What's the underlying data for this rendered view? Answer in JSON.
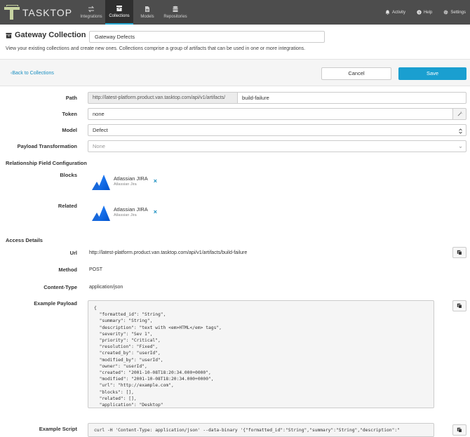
{
  "nav": {
    "logo_text": "TASKTOP",
    "items": [
      {
        "label": "Integrations",
        "icon": "integrations-icon"
      },
      {
        "label": "Collections",
        "icon": "collections-icon",
        "active": true
      },
      {
        "label": "Models",
        "icon": "models-icon"
      },
      {
        "label": "Repositories",
        "icon": "repositories-icon"
      }
    ],
    "right": {
      "activity": "Activity",
      "help": "Help",
      "settings": "Settings"
    },
    "accent_color": "#29abd4"
  },
  "header": {
    "title": "Gateway Collection",
    "name_value": "Gateway Defects",
    "description": "View your existing collections and create new ones. Collections comprise a group of artifacts that can be used in one or more integrations."
  },
  "actions": {
    "back": "Back to Collections",
    "cancel": "Cancel",
    "save": "Save",
    "save_color": "#1a9fd0"
  },
  "form": {
    "path": {
      "label": "Path",
      "prefix": "http://latest-platform.product.van.tasktop.com/api/v1/artifacts/",
      "value": "build-failure"
    },
    "token": {
      "label": "Token",
      "value": "none"
    },
    "model": {
      "label": "Model",
      "value": "Defect"
    },
    "payload_transformation": {
      "label": "Payload Transformation",
      "value": "None"
    }
  },
  "relationships": {
    "title": "Relationship Field Configuration",
    "blocks": {
      "label": "Blocks",
      "item_name": "Atlassian JIRA",
      "item_sub": "Atlassian Jira"
    },
    "related": {
      "label": "Related",
      "item_name": "Atlassian JIRA",
      "item_sub": "Atlassian Jira"
    },
    "remove_glyph": "×"
  },
  "access": {
    "title": "Access Details",
    "url": {
      "label": "Url",
      "value": "http://latest-platform.product.van.tasktop.com/api/v1/artifacts/build-failure"
    },
    "method": {
      "label": "Method",
      "value": "POST"
    },
    "content_type": {
      "label": "Content-Type",
      "value": "application/json"
    },
    "example_payload": {
      "label": "Example Payload",
      "text": "{\n  \"formatted_id\": \"String\",\n  \"summary\": \"String\",\n  \"description\": \"text with <em>HTML</em> tags\",\n  \"severity\": \"Sev 1\",\n  \"priority\": \"Critical\",\n  \"resolution\": \"Fixed\",\n  \"created_by\": \"userId\",\n  \"modified_by\": \"userId\",\n  \"owner\": \"userId\",\n  \"created\": \"2001-10-08T18:20:34.000+0000\",\n  \"modified\": \"2001-10-08T18:20:34.000+0000\",\n  \"url\": \"http://example.com\",\n  \"blocks\": [],\n  \"related\": [],\n  \"application\": \"Desktop\""
    },
    "example_script": {
      "label": "Example Script",
      "text": "curl -H 'Content-Type: application/json' --data-binary '{\"formatted_id\":\"String\",\"summary\":\"String\",\"description\":\""
    }
  }
}
